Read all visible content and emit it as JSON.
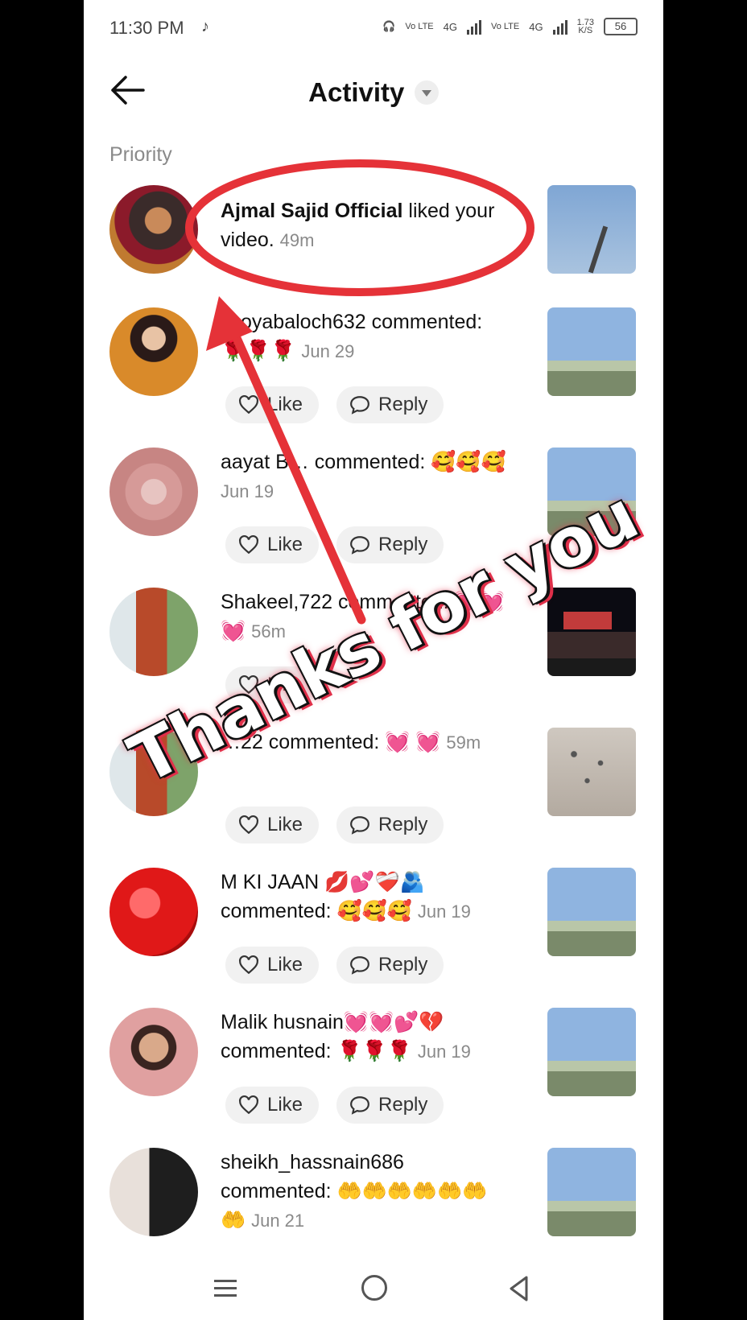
{
  "status_bar": {
    "time": "11:30 PM",
    "vo_lte_1": "Vo LTE",
    "net_1": "4G",
    "vo_lte_2": "Vo LTE",
    "net_2": "4G",
    "speed": "1.73",
    "speed_unit": "K/S",
    "battery": "56"
  },
  "header": {
    "title": "Activity"
  },
  "section_label": "Priority",
  "action_labels": {
    "like": "Like",
    "reply": "Reply"
  },
  "items": [
    {
      "name": "Ajmal Sajid Official",
      "action": " liked your video.",
      "time": "49m"
    },
    {
      "name": "…oyabaloch632",
      "action": " commented: 🌹🌹🌹",
      "time": "Jun 29"
    },
    {
      "name": "aayat B…",
      "action": " commented: 🥰🥰🥰",
      "time": "Jun 19"
    },
    {
      "name": "Shakeel,722",
      "action": " commented: 💓💓💓",
      "time": "56m"
    },
    {
      "name": "…22",
      "action": " commented: 💓 💓",
      "time": "59m"
    },
    {
      "name": "M KI JAAN 💋💕❤️‍🩹🫂",
      "action": " commented: 🥰🥰🥰",
      "time": "Jun 19"
    },
    {
      "name": "Malik husnain💓💓💕💔",
      "action": " commented: 🌹🌹🌹",
      "time": "Jun 19"
    },
    {
      "name": "sheikh_hassnain686",
      "action": " commented: 🤲🤲🤲🤲🤲🤲🤲",
      "time": "Jun 21"
    }
  ],
  "overlay_text": "Thanks for you",
  "colors": {
    "annotation_red": "#e53238",
    "pill_bg": "#f1f1f1",
    "meta_gray": "#8a8a8a"
  }
}
